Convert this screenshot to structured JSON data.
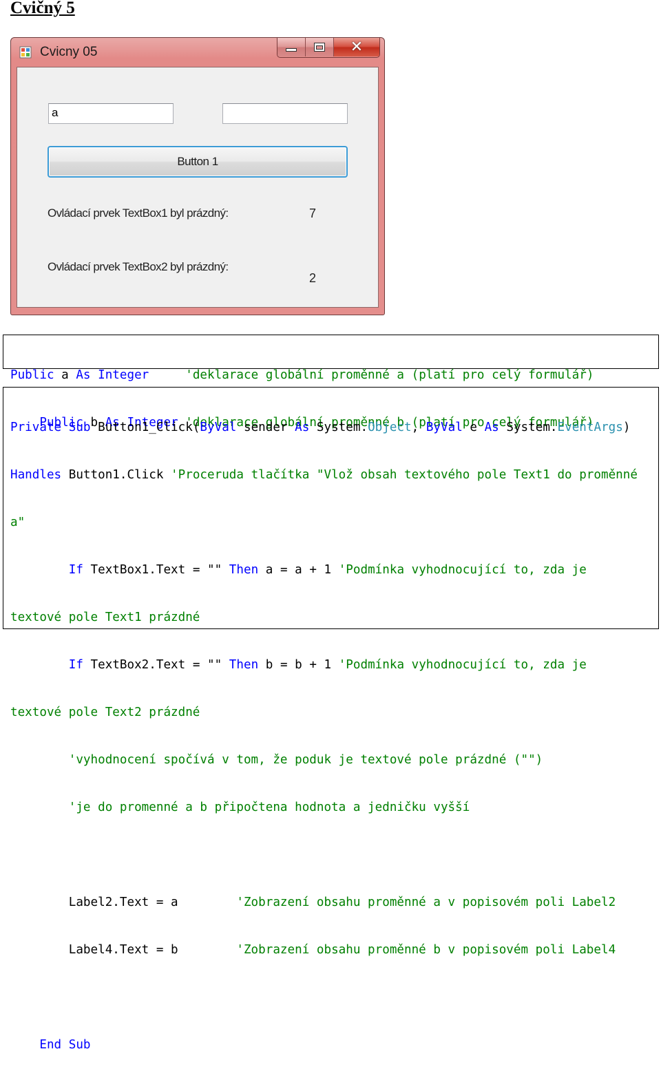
{
  "doc": {
    "title": "Cvičný 5"
  },
  "window": {
    "title": "Cvicny 05",
    "textbox1_value": "a",
    "textbox2_value": "",
    "button_label": "Button 1",
    "label1": "Ovládací prvek TextBox1 byl prázdný:",
    "label2_value": "7",
    "label3": "Ovládací prvek TextBox2 byl prázdný:",
    "label4_value": "2",
    "close_glyph": "✕"
  },
  "code1": {
    "l1": {
      "kw1": "Public",
      "id": " a ",
      "kw2": "As",
      "kw3": " Integer",
      "cm": "     'deklarace globální proměnné a (platí pro celý formulář)"
    },
    "l2": {
      "indent": "    ",
      "kw1": "Public",
      "id": " b ",
      "kw2": "As",
      "kw3": " Integer",
      "cm": " 'deklarace globální proměnné b (platí pro celý formulář)"
    }
  },
  "code2": {
    "l1": {
      "kw1": "Private",
      "sp1": " ",
      "kw2": "Sub",
      "t1": " Button1_Click(",
      "kw3": "ByVal",
      "t2": " sender ",
      "kw4": "As",
      "t3": " System.",
      "ty1": "Object",
      "t4": ", ",
      "kw5": "ByVal",
      "t5": " e ",
      "kw6": "As",
      "t6": " System.",
      "ty2": "EventArgs",
      "t7": ")"
    },
    "l2": {
      "kw1": "Handles",
      "t1": " Button1.Click ",
      "cm": "'Proceruda tlačítka \"Vlož obsah textového pole Text1 do proměnné"
    },
    "l3": {
      "cm": "a\""
    },
    "l4": {
      "indent": "        ",
      "kw1": "If",
      "t1": " TextBox1.Text = ",
      "str": "\"\"",
      "sp": " ",
      "kw2": "Then",
      "t2": " a = a + 1 ",
      "cm": "'Podmínka vyhodnocující to, zda je"
    },
    "l5": {
      "cm": "textové pole Text1 prázdné"
    },
    "l6": {
      "indent": "        ",
      "kw1": "If",
      "t1": " TextBox2.Text = ",
      "str": "\"\"",
      "sp": " ",
      "kw2": "Then",
      "t2": " b = b + 1 ",
      "cm": "'Podmínka vyhodnocující to, zda je"
    },
    "l7": {
      "cm": "textové pole Text2 prázdné"
    },
    "l8": {
      "indent": "        ",
      "cm": "'vyhodnocení spočívá v tom, že poduk je textové pole prázdné (\"\")"
    },
    "l9": {
      "indent": "        ",
      "cm": "'je do promenné a b připočtena hodnota a jedničku vyšší"
    },
    "l11": {
      "indent": "        ",
      "t1": "Label2.Text = a        ",
      "cm": "'Zobrazení obsahu proměnné a v popisovém poli Label2"
    },
    "l12": {
      "indent": "        ",
      "t1": "Label4.Text = b        ",
      "cm": "'Zobrazení obsahu proměnné b v popisovém poli Label4"
    },
    "l14": {
      "indent": "    ",
      "kw1": "End",
      "sp": " ",
      "kw2": "Sub"
    }
  }
}
